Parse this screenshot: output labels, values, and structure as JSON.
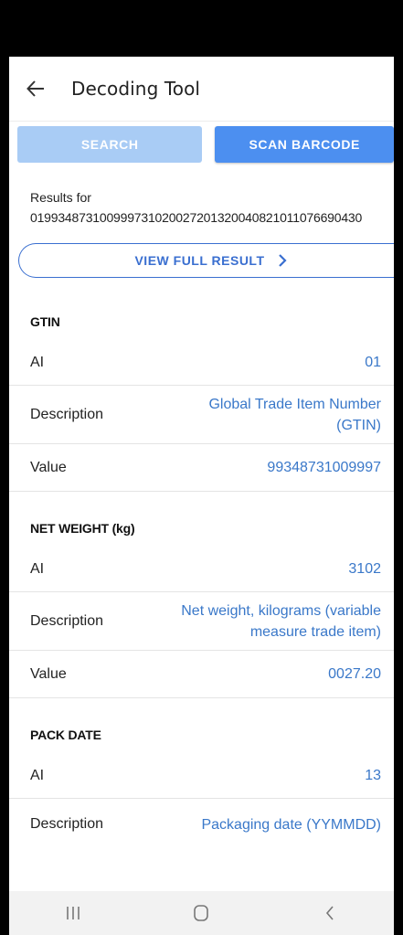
{
  "header": {
    "title": "Decoding Tool"
  },
  "actions": {
    "search_label": "SEARCH",
    "scan_label": "SCAN BARCODE"
  },
  "results": {
    "label": "Results for",
    "code": "01993487310099973102002720132004082101107669043​0",
    "full_result_label": "VIEW FULL RESULT"
  },
  "sections": [
    {
      "title": "GTIN",
      "rows": [
        {
          "key": "AI",
          "value": "01"
        },
        {
          "key": "Description",
          "value": "Global Trade Item Number (GTIN)"
        },
        {
          "key": "Value",
          "value": "99348731009997"
        }
      ]
    },
    {
      "title": "NET WEIGHT (kg)",
      "rows": [
        {
          "key": "AI",
          "value": "3102"
        },
        {
          "key": "Description",
          "value": "Net weight, kilograms (variable measure trade item)"
        },
        {
          "key": "Value",
          "value": "0027.20"
        }
      ]
    },
    {
      "title": "PACK DATE",
      "rows": [
        {
          "key": "AI",
          "value": "13"
        },
        {
          "key": "Description",
          "value": "Packaging date (YYMMDD)"
        }
      ]
    }
  ],
  "nav": {
    "recent_icon": "recent-apps-icon",
    "home_icon": "home-icon",
    "back_icon": "back-icon"
  },
  "colors": {
    "accent": "#4c8ff0",
    "accent_disabled": "#a9ccf5",
    "link": "#3a78c9"
  }
}
